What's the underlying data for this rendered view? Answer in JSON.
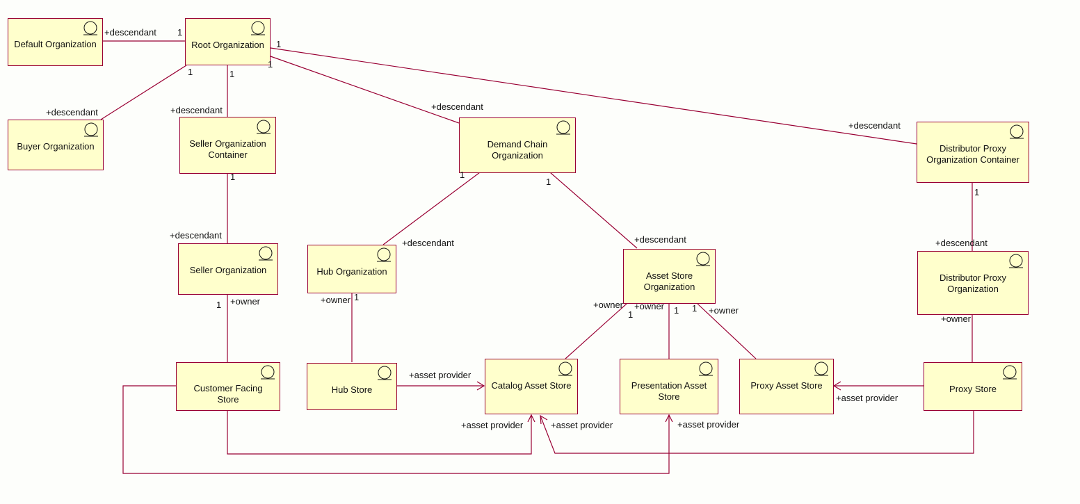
{
  "diagram": {
    "type": "uml-class-diagram",
    "colors": {
      "box_fill": "#ffffcc",
      "box_border": "#990033",
      "line": "#990033",
      "background": "#fdfefb"
    },
    "classes": [
      {
        "id": "default-org",
        "name": "Default Organization",
        "stereotype_icon": "entity-icon"
      },
      {
        "id": "root-org",
        "name": "Root Organization",
        "stereotype_icon": "entity-icon"
      },
      {
        "id": "buyer-org",
        "name": "Buyer Organization",
        "stereotype_icon": "entity-icon"
      },
      {
        "id": "seller-org-container",
        "name": "Seller Organization Container",
        "stereotype_icon": "entity-icon"
      },
      {
        "id": "demand-chain-org",
        "name": "Demand Chain Organization",
        "stereotype_icon": "entity-icon"
      },
      {
        "id": "distributor-proxy-container",
        "name": "Distributor Proxy Organization Container",
        "stereotype_icon": "entity-icon"
      },
      {
        "id": "seller-org",
        "name": "Seller Organization",
        "stereotype_icon": "entity-icon"
      },
      {
        "id": "hub-org",
        "name": "Hub Organization",
        "stereotype_icon": "entity-icon"
      },
      {
        "id": "asset-store-org",
        "name": "Asset Store Organization",
        "stereotype_icon": "entity-icon"
      },
      {
        "id": "distributor-proxy-org",
        "name": "Distributor Proxy Organization",
        "stereotype_icon": "entity-icon"
      },
      {
        "id": "customer-facing-store",
        "name": "Customer Facing Store",
        "stereotype_icon": "entity-icon"
      },
      {
        "id": "hub-store",
        "name": "Hub Store",
        "stereotype_icon": "entity-icon"
      },
      {
        "id": "catalog-asset-store",
        "name": "Catalog Asset Store",
        "stereotype_icon": "entity-icon"
      },
      {
        "id": "presentation-asset-store",
        "name": "Presentation Asset Store",
        "stereotype_icon": "entity-icon"
      },
      {
        "id": "proxy-asset-store",
        "name": "Proxy Asset Store",
        "stereotype_icon": "entity-icon"
      },
      {
        "id": "proxy-store",
        "name": "Proxy Store",
        "stereotype_icon": "entity-icon"
      }
    ],
    "associations": [
      {
        "from": "root-org",
        "to": "default-org",
        "from_mult": "1",
        "to_role": "+descendant"
      },
      {
        "from": "root-org",
        "to": "buyer-org",
        "from_mult": "1",
        "to_role": "+descendant"
      },
      {
        "from": "root-org",
        "to": "seller-org-container",
        "from_mult": "1",
        "to_role": "+descendant"
      },
      {
        "from": "root-org",
        "to": "demand-chain-org",
        "from_mult": "1",
        "to_role": "+descendant"
      },
      {
        "from": "root-org",
        "to": "distributor-proxy-container",
        "from_mult": "1",
        "to_role": "+descendant"
      },
      {
        "from": "seller-org-container",
        "to": "seller-org",
        "from_mult": "1",
        "to_role": "+descendant"
      },
      {
        "from": "demand-chain-org",
        "to": "hub-org",
        "from_mult": "1",
        "to_role": "+descendant"
      },
      {
        "from": "demand-chain-org",
        "to": "asset-store-org",
        "from_mult": "1",
        "to_role": "+descendant"
      },
      {
        "from": "distributor-proxy-container",
        "to": "distributor-proxy-org",
        "from_mult": "1",
        "to_role": "+descendant"
      },
      {
        "from": "seller-org",
        "to": "customer-facing-store",
        "from_mult": "1",
        "from_role": "+owner"
      },
      {
        "from": "hub-org",
        "to": "hub-store",
        "from_mult": "1",
        "from_role": "+owner"
      },
      {
        "from": "asset-store-org",
        "to": "catalog-asset-store",
        "from_mult": "1",
        "from_role": "+owner"
      },
      {
        "from": "asset-store-org",
        "to": "presentation-asset-store",
        "from_mult": "1",
        "from_role": "+owner"
      },
      {
        "from": "asset-store-org",
        "to": "proxy-asset-store",
        "from_mult": "1",
        "from_role": "+owner"
      },
      {
        "from": "distributor-proxy-org",
        "to": "proxy-store",
        "from_role": "+owner"
      },
      {
        "from": "hub-store",
        "to": "catalog-asset-store",
        "to_role": "+asset provider",
        "navigable": true
      },
      {
        "from": "customer-facing-store",
        "to": "catalog-asset-store",
        "to_role": "+asset provider",
        "navigable": true
      },
      {
        "from": "proxy-store",
        "to": "catalog-asset-store",
        "to_role": "+asset provider",
        "navigable": true
      },
      {
        "from": "customer-facing-store",
        "to": "presentation-asset-store",
        "to_role": "+asset provider",
        "navigable": true
      },
      {
        "from": "proxy-store",
        "to": "proxy-asset-store",
        "to_role": "+asset provider",
        "navigable": true
      }
    ],
    "labels": {
      "descendant": "+descendant",
      "owner": "+owner",
      "asset_provider": "+asset provider",
      "one": "1"
    }
  }
}
